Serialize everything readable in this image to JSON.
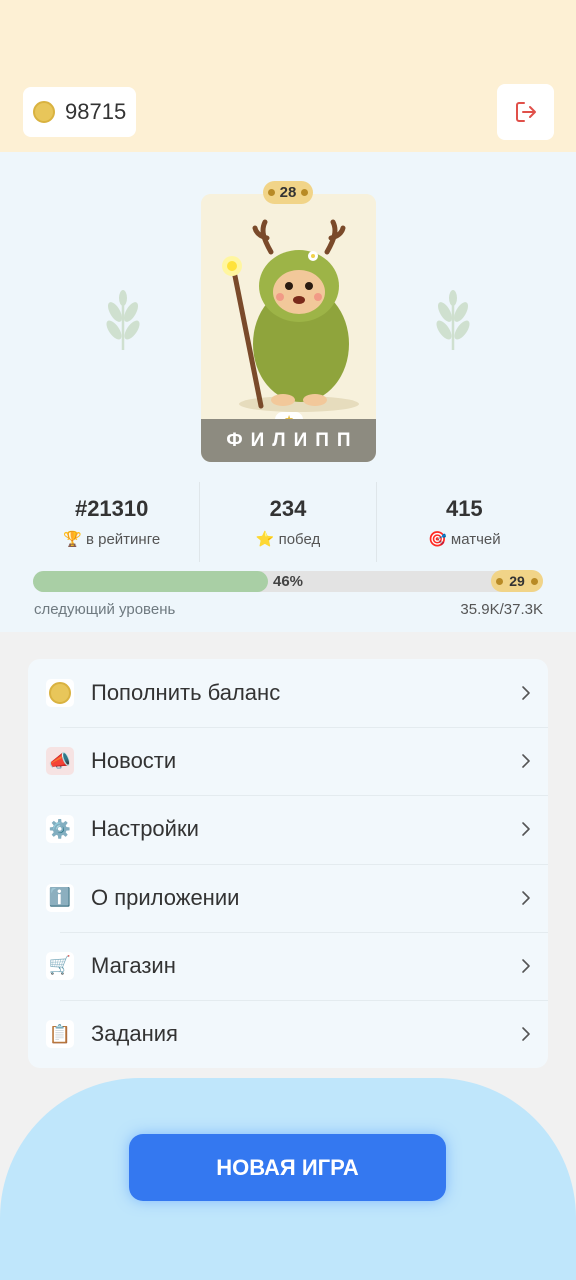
{
  "header": {
    "coin_icon": "coin-icon",
    "balance": "98715",
    "logout_icon": "logout-icon",
    "accent": "#e0504a"
  },
  "character": {
    "level": "28",
    "name": "ФИЛИПП",
    "image": "forest-creature-with-staff"
  },
  "stats": [
    {
      "value": "#21310",
      "label": "в рейтинге",
      "icon": "🏆"
    },
    {
      "value": "234",
      "label": "побед",
      "icon": "⭐"
    },
    {
      "value": "415",
      "label": "матчей",
      "icon": "🎯"
    }
  ],
  "xp": {
    "percent_label": "46%",
    "fill_fraction": 0.46,
    "next_level": "29",
    "caption": "следующий уровень",
    "progress": "35.9K/37.3K"
  },
  "menu": [
    {
      "label": "Пополнить баланс",
      "icon": "coin-icon"
    },
    {
      "label": "Новости",
      "icon": "megaphone-icon"
    },
    {
      "label": "Настройки",
      "icon": "gear-icon"
    },
    {
      "label": "О приложении",
      "icon": "info-icon"
    },
    {
      "label": "Магазин",
      "icon": "cart-icon"
    },
    {
      "label": "Задания",
      "icon": "clipboard-icon"
    }
  ],
  "actions": {
    "new_game": "НОВАЯ ИГРА",
    "button_color": "#3478f0"
  }
}
